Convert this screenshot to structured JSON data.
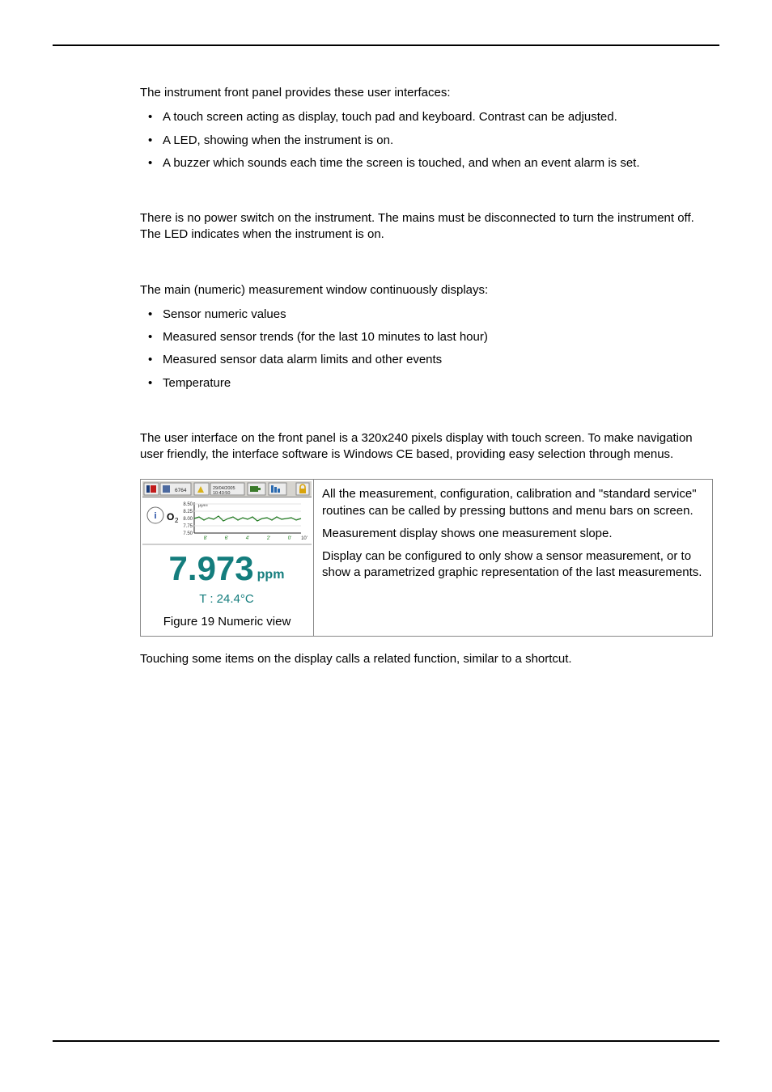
{
  "p_intro": "The instrument front panel provides these user interfaces:",
  "bullets1": [
    "A touch screen acting as display, touch pad and keyboard. Contrast can be adjusted.",
    "A LED, showing when the instrument is on.",
    "A buzzer which sounds each time the screen is touched, and when an event alarm is set."
  ],
  "p_power": "There is no power switch on the instrument. The mains must be disconnected to turn the instrument off. The LED indicates when the instrument is on.",
  "p_main_intro": "The main (numeric) measurement window continuously displays:",
  "bullets2": [
    "Sensor numeric values",
    "Measured sensor trends (for the last 10 minutes to last hour)",
    "Measured sensor data alarm limits and other events",
    "Temperature"
  ],
  "p_ui": "The user interface on the front panel is a 320x240 pixels display with touch screen. To make navigation user friendly, the interface software is Windows CE based, providing easy selection through menus.",
  "figure": {
    "caption": "Figure 19  Numeric view",
    "shot": {
      "header_id": "6764",
      "date": "29/04/2005",
      "time": "10:43:50",
      "o2_label": "O",
      "o2_sub": "2",
      "y_ticks": [
        "8.50",
        "8.25",
        "8.00",
        "7.75",
        "7.50"
      ],
      "y_unit": "ppm",
      "x_ticks": [
        "8'",
        "6'",
        "4'",
        "2'",
        "0'",
        "10'"
      ],
      "big_value": "7.973",
      "big_unit": "ppm",
      "temp": "T : 24.4°C"
    }
  },
  "desc": {
    "p1": "All the measurement, configuration, calibration and \"standard service\" routines can be called by pressing buttons and menu bars on screen.",
    "p2": "Measurement display shows one measurement slope.",
    "p3": "Display can be configured to only show a sensor measurement, or to show a parametrized graphic representation of the last measurements."
  },
  "p_touch": "Touching some items on the display calls a related function, similar to a shortcut."
}
